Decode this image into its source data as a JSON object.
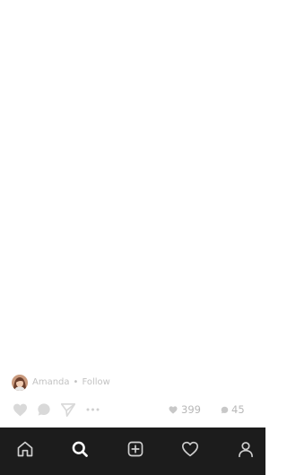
{
  "post": {
    "author_name": "Amanda",
    "separator": "•",
    "follow_label": "Follow",
    "likes_count": "399",
    "comments_count": "45"
  },
  "tabbar": {
    "items": [
      {
        "icon": "home-icon",
        "active": false
      },
      {
        "icon": "search-icon",
        "active": true
      },
      {
        "icon": "add-post-icon",
        "active": false
      },
      {
        "icon": "heart-icon",
        "active": false
      },
      {
        "icon": "profile-icon",
        "active": false
      }
    ]
  },
  "colors": {
    "tabbar_bg": "#1c1c1c",
    "icon_inactive": "#cfcfcf",
    "icon_active": "#ffffff",
    "muted_text": "#c2c2c2",
    "action_icons": "#d9d9d9"
  }
}
